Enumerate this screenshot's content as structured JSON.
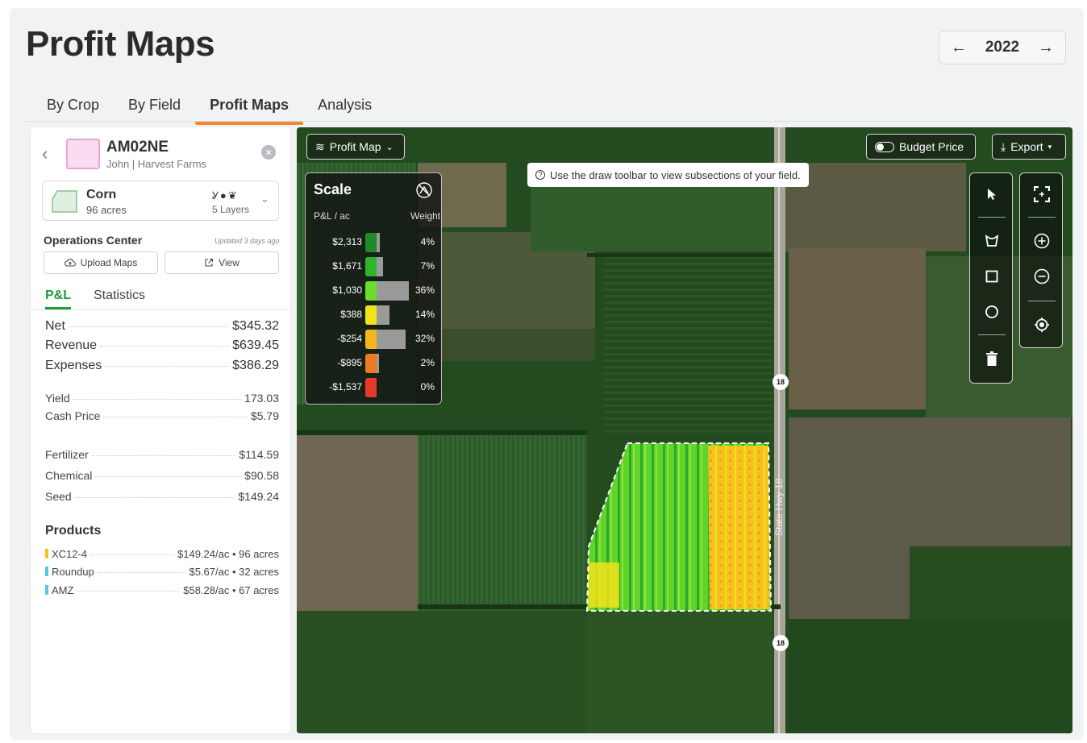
{
  "page": {
    "title": "Profit Maps",
    "year": "2022",
    "prev_icon": "arrow-left-icon",
    "next_icon": "arrow-right-icon"
  },
  "tabs": [
    {
      "label": "By Crop",
      "active": false
    },
    {
      "label": "By Field",
      "active": false
    },
    {
      "label": "Profit Maps",
      "active": true
    },
    {
      "label": "Analysis",
      "active": false
    }
  ],
  "field": {
    "name": "AM02NE",
    "farm": "John | Harvest Farms",
    "crop": "Corn",
    "acres": "96 acres",
    "layers": "5 Layers",
    "layer_icons": [
      "seedling-icon",
      "droplet-icon",
      "leaf-icon"
    ]
  },
  "operations": {
    "title": "Operations Center",
    "updated": "Updated 3 days ago",
    "upload_label": "Upload Maps",
    "view_label": "View"
  },
  "subtabs": [
    {
      "label": "P&L",
      "active": true
    },
    {
      "label": "Statistics",
      "active": false
    }
  ],
  "pl_main": [
    {
      "label": "Net",
      "value": "$345.32"
    },
    {
      "label": "Revenue",
      "value": "$639.45"
    },
    {
      "label": "Expenses",
      "value": "$386.29"
    }
  ],
  "pl_yield": [
    {
      "label": "Yield",
      "value": "173.03"
    },
    {
      "label": "Cash Price",
      "value": "$5.79"
    }
  ],
  "pl_costs": [
    {
      "label": "Fertilizer",
      "value": "$114.59"
    },
    {
      "label": "Chemical",
      "value": "$90.58"
    },
    {
      "label": "Seed",
      "value": "$149.24"
    }
  ],
  "products": {
    "title": "Products",
    "items": [
      {
        "name": "XC12-4",
        "value": "$149.24/ac • 96 acres",
        "color": "#f4c21b"
      },
      {
        "name": "Roundup",
        "value": "$5.67/ac • 32 acres",
        "color": "#53c8e8"
      },
      {
        "name": "AMZ",
        "value": "$58.28/ac • 67 acres",
        "color": "#53c8e8"
      }
    ]
  },
  "map": {
    "layer_label": "Profit Map",
    "budget_label": "Budget Price",
    "export_label": "Export",
    "tooltip": "Use the draw toolbar to view subsections of your field.",
    "road_label": "State Hwy 18",
    "shield_label": "18"
  },
  "scale": {
    "title": "Scale",
    "col_pl": "P&L / ac",
    "col_weight": "Weight",
    "rows": [
      {
        "pl": "$2,313",
        "weight": "4%",
        "weight_value": 4,
        "color": "#1e8a2a"
      },
      {
        "pl": "$1,671",
        "weight": "7%",
        "weight_value": 7,
        "color": "#2fb52c"
      },
      {
        "pl": "$1,030",
        "weight": "36%",
        "weight_value": 36,
        "color": "#6bdc2a"
      },
      {
        "pl": "$388",
        "weight": "14%",
        "weight_value": 14,
        "color": "#f3e21a"
      },
      {
        "pl": "-$254",
        "weight": "32%",
        "weight_value": 32,
        "color": "#f5b51e"
      },
      {
        "pl": "-$895",
        "weight": "2%",
        "weight_value": 2,
        "color": "#ee7a22"
      },
      {
        "pl": "-$1,537",
        "weight": "0%",
        "weight_value": 0,
        "color": "#e43a2a"
      }
    ]
  },
  "toolbar": {
    "draw_tools": [
      "pointer-icon",
      "polygon-icon",
      "square-icon",
      "circle-icon",
      "trash-icon"
    ],
    "view_tools": [
      "fit-screen-icon",
      "zoom-in-icon",
      "zoom-out-icon",
      "locate-icon"
    ]
  }
}
